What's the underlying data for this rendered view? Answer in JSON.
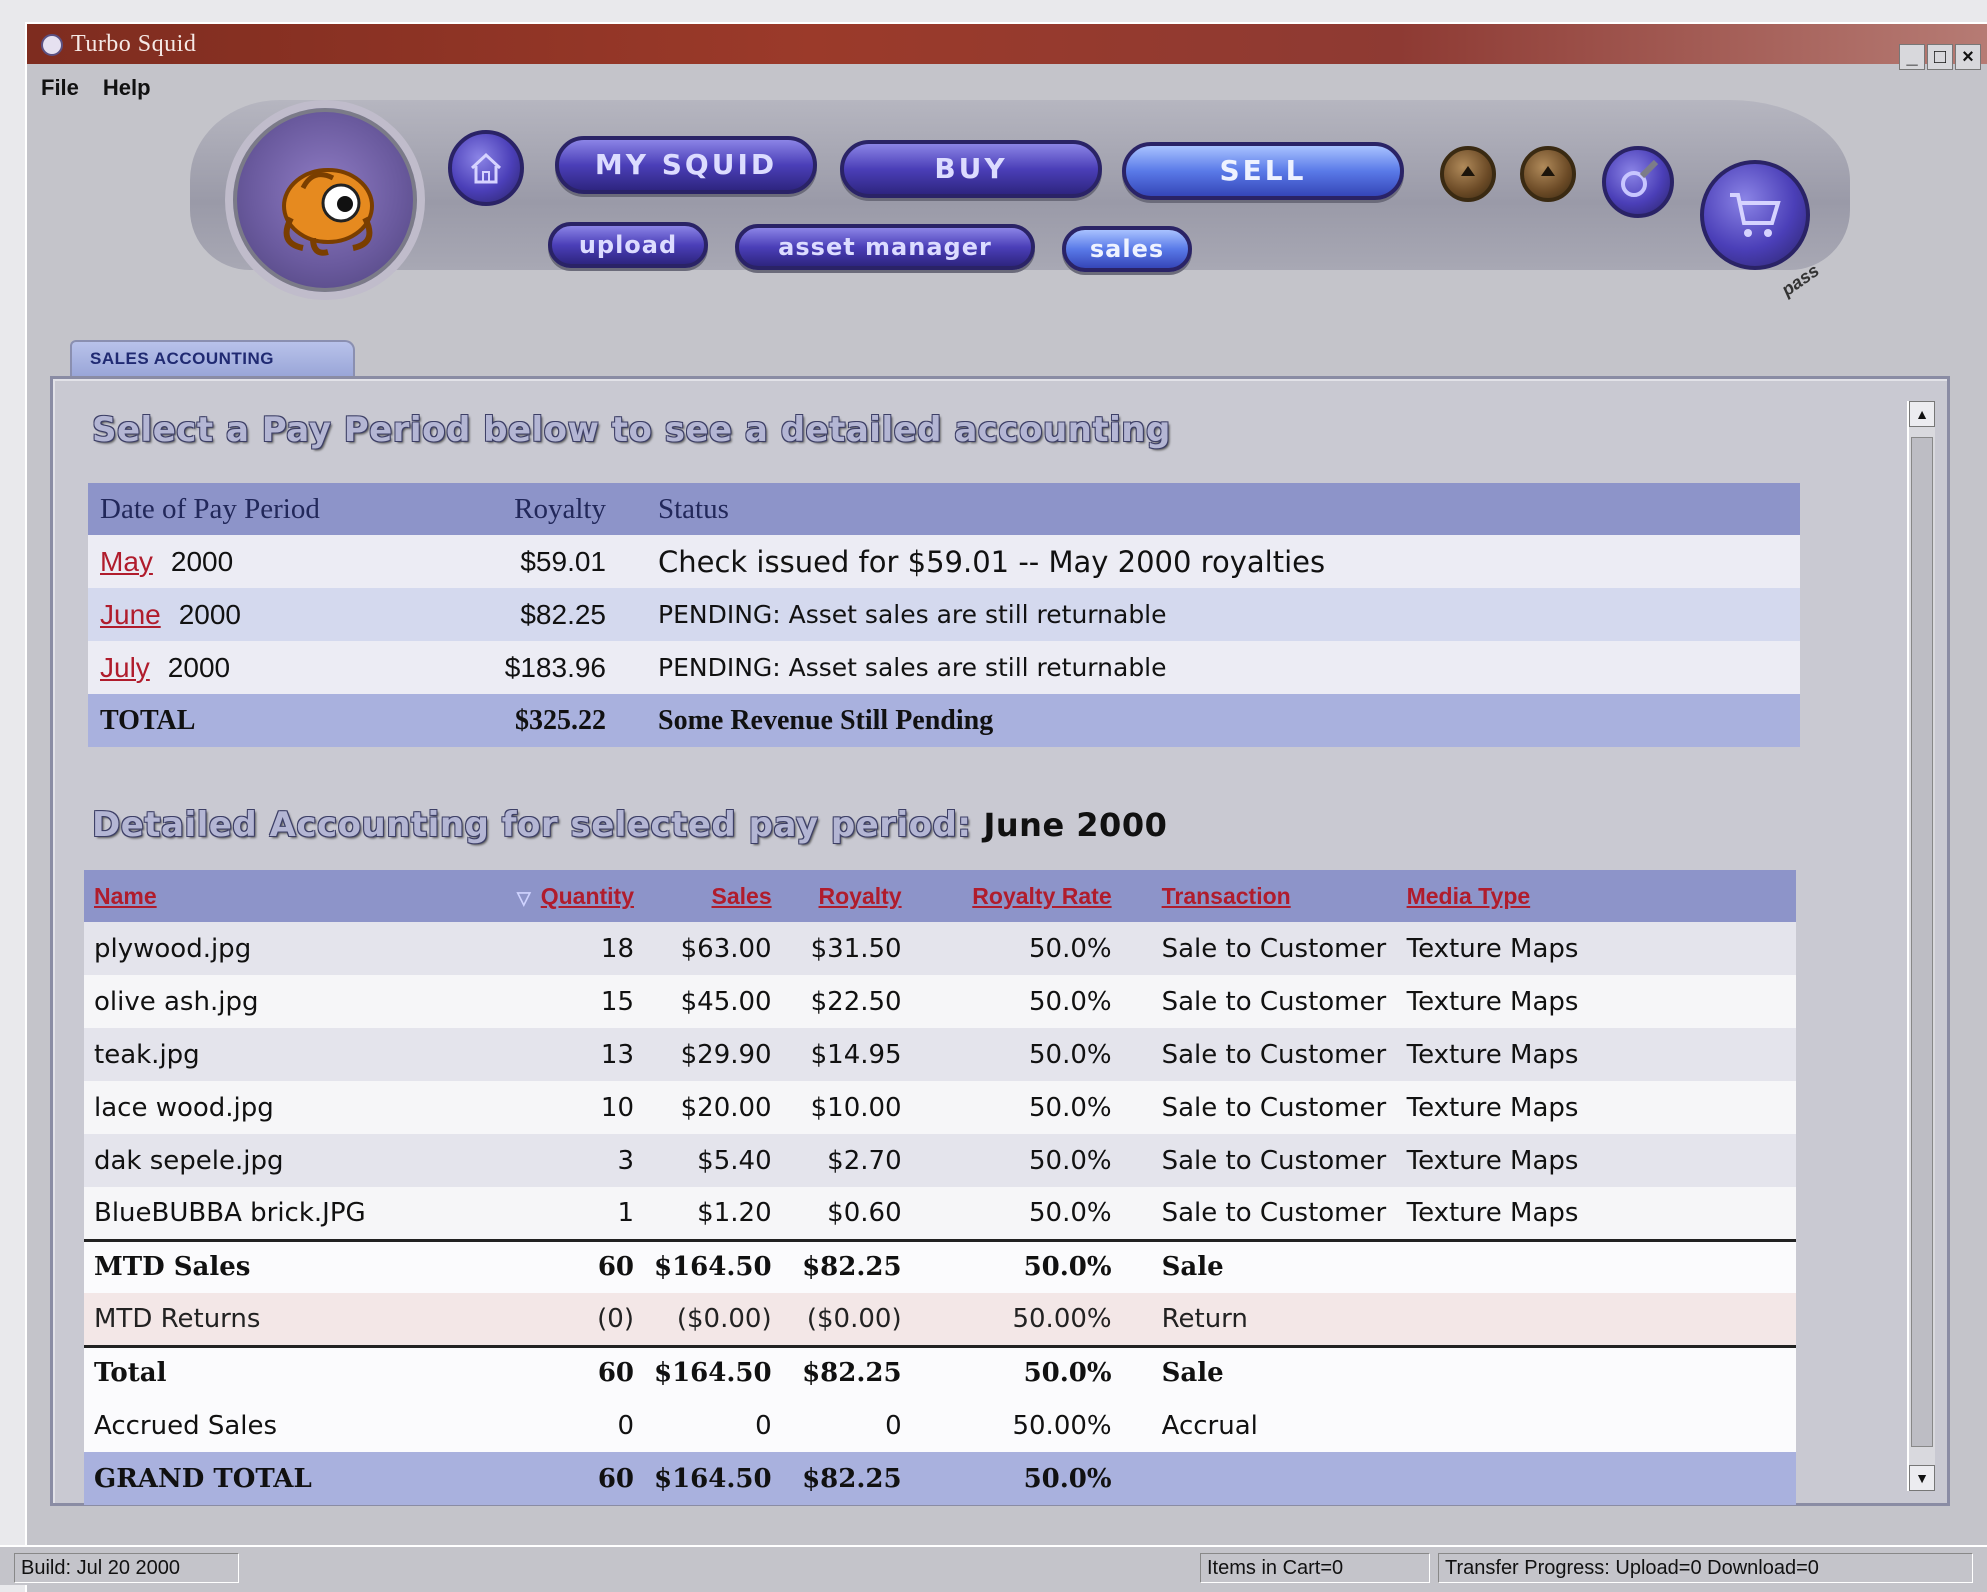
{
  "window": {
    "title": "Turbo Squid",
    "controls": {
      "minimize": "_",
      "maximize": "□",
      "close": "×"
    }
  },
  "menu": [
    "File",
    "Help"
  ],
  "nav": {
    "main": [
      "MY SQUID",
      "BUY",
      "SELL"
    ],
    "active": "SELL",
    "sub": [
      "upload",
      "asset manager",
      "sales"
    ],
    "brand_mark": "pass"
  },
  "tab": {
    "label": "SALES ACCOUNTING"
  },
  "pay_period": {
    "heading": "Select a Pay Period below to see a detailed accounting",
    "columns": [
      "Date of Pay Period",
      "Royalty",
      "Status"
    ],
    "rows": [
      {
        "month": "May",
        "year": "2000",
        "royalty": "$59.01",
        "status": "Check issued for $59.01 -- May 2000 royalties"
      },
      {
        "month": "June",
        "year": "2000",
        "royalty": "$82.25",
        "status": "PENDING: Asset sales are still returnable"
      },
      {
        "month": "July",
        "year": "2000",
        "royalty": "$183.96",
        "status": "PENDING: Asset sales are still returnable"
      }
    ],
    "total": {
      "label": "TOTAL",
      "royalty": "$325.22",
      "status": "Some Revenue Still Pending"
    }
  },
  "detail": {
    "heading": "Detailed Accounting for selected pay period:",
    "selected_period": "June 2000",
    "columns": [
      "Name",
      "Quantity",
      "Sales",
      "Royalty",
      "Royalty Rate",
      "Transaction",
      "Media Type"
    ],
    "sort_indicator": "▽",
    "rows": [
      [
        "plywood.jpg",
        "18",
        "$63.00",
        "$31.50",
        "50.0%",
        "Sale to Customer",
        "Texture Maps"
      ],
      [
        "olive ash.jpg",
        "15",
        "$45.00",
        "$22.50",
        "50.0%",
        "Sale to Customer",
        "Texture Maps"
      ],
      [
        "teak.jpg",
        "13",
        "$29.90",
        "$14.95",
        "50.0%",
        "Sale to Customer",
        "Texture Maps"
      ],
      [
        "lace wood.jpg",
        "10",
        "$20.00",
        "$10.00",
        "50.0%",
        "Sale to Customer",
        "Texture Maps"
      ],
      [
        "dak sepele.jpg",
        "3",
        "$5.40",
        "$2.70",
        "50.0%",
        "Sale to Customer",
        "Texture Maps"
      ],
      [
        "BlueBUBBA brick.JPG",
        "1",
        "$1.20",
        "$0.60",
        "50.0%",
        "Sale to Customer",
        "Texture Maps"
      ]
    ],
    "mtd_sales": [
      "MTD Sales",
      "60",
      "$164.50",
      "$82.25",
      "50.0%",
      "Sale"
    ],
    "mtd_returns": [
      "MTD Returns",
      "(0)",
      "($0.00)",
      "($0.00)",
      "50.00%",
      "Return"
    ],
    "total": [
      "Total",
      "60",
      "$164.50",
      "$82.25",
      "50.0%",
      "Sale"
    ],
    "accrued": [
      "Accrued Sales",
      "0",
      "0",
      "0",
      "50.00%",
      "Accrual"
    ],
    "grand_total": [
      "GRAND TOTAL",
      "60",
      "$164.50",
      "$82.25",
      "50.0%"
    ]
  },
  "status_bar": {
    "build": "Build: Jul 20 2000",
    "cart": "Items in Cart=0",
    "transfer": "Transfer Progress: Upload=0 Download=0"
  },
  "colors": {
    "title_bar": "#9b3a2a",
    "nav_pill": "#4b3fb8",
    "table_header": "#8d94c9",
    "link_red": "#b01c2c",
    "total_row": "#a9b1de"
  }
}
